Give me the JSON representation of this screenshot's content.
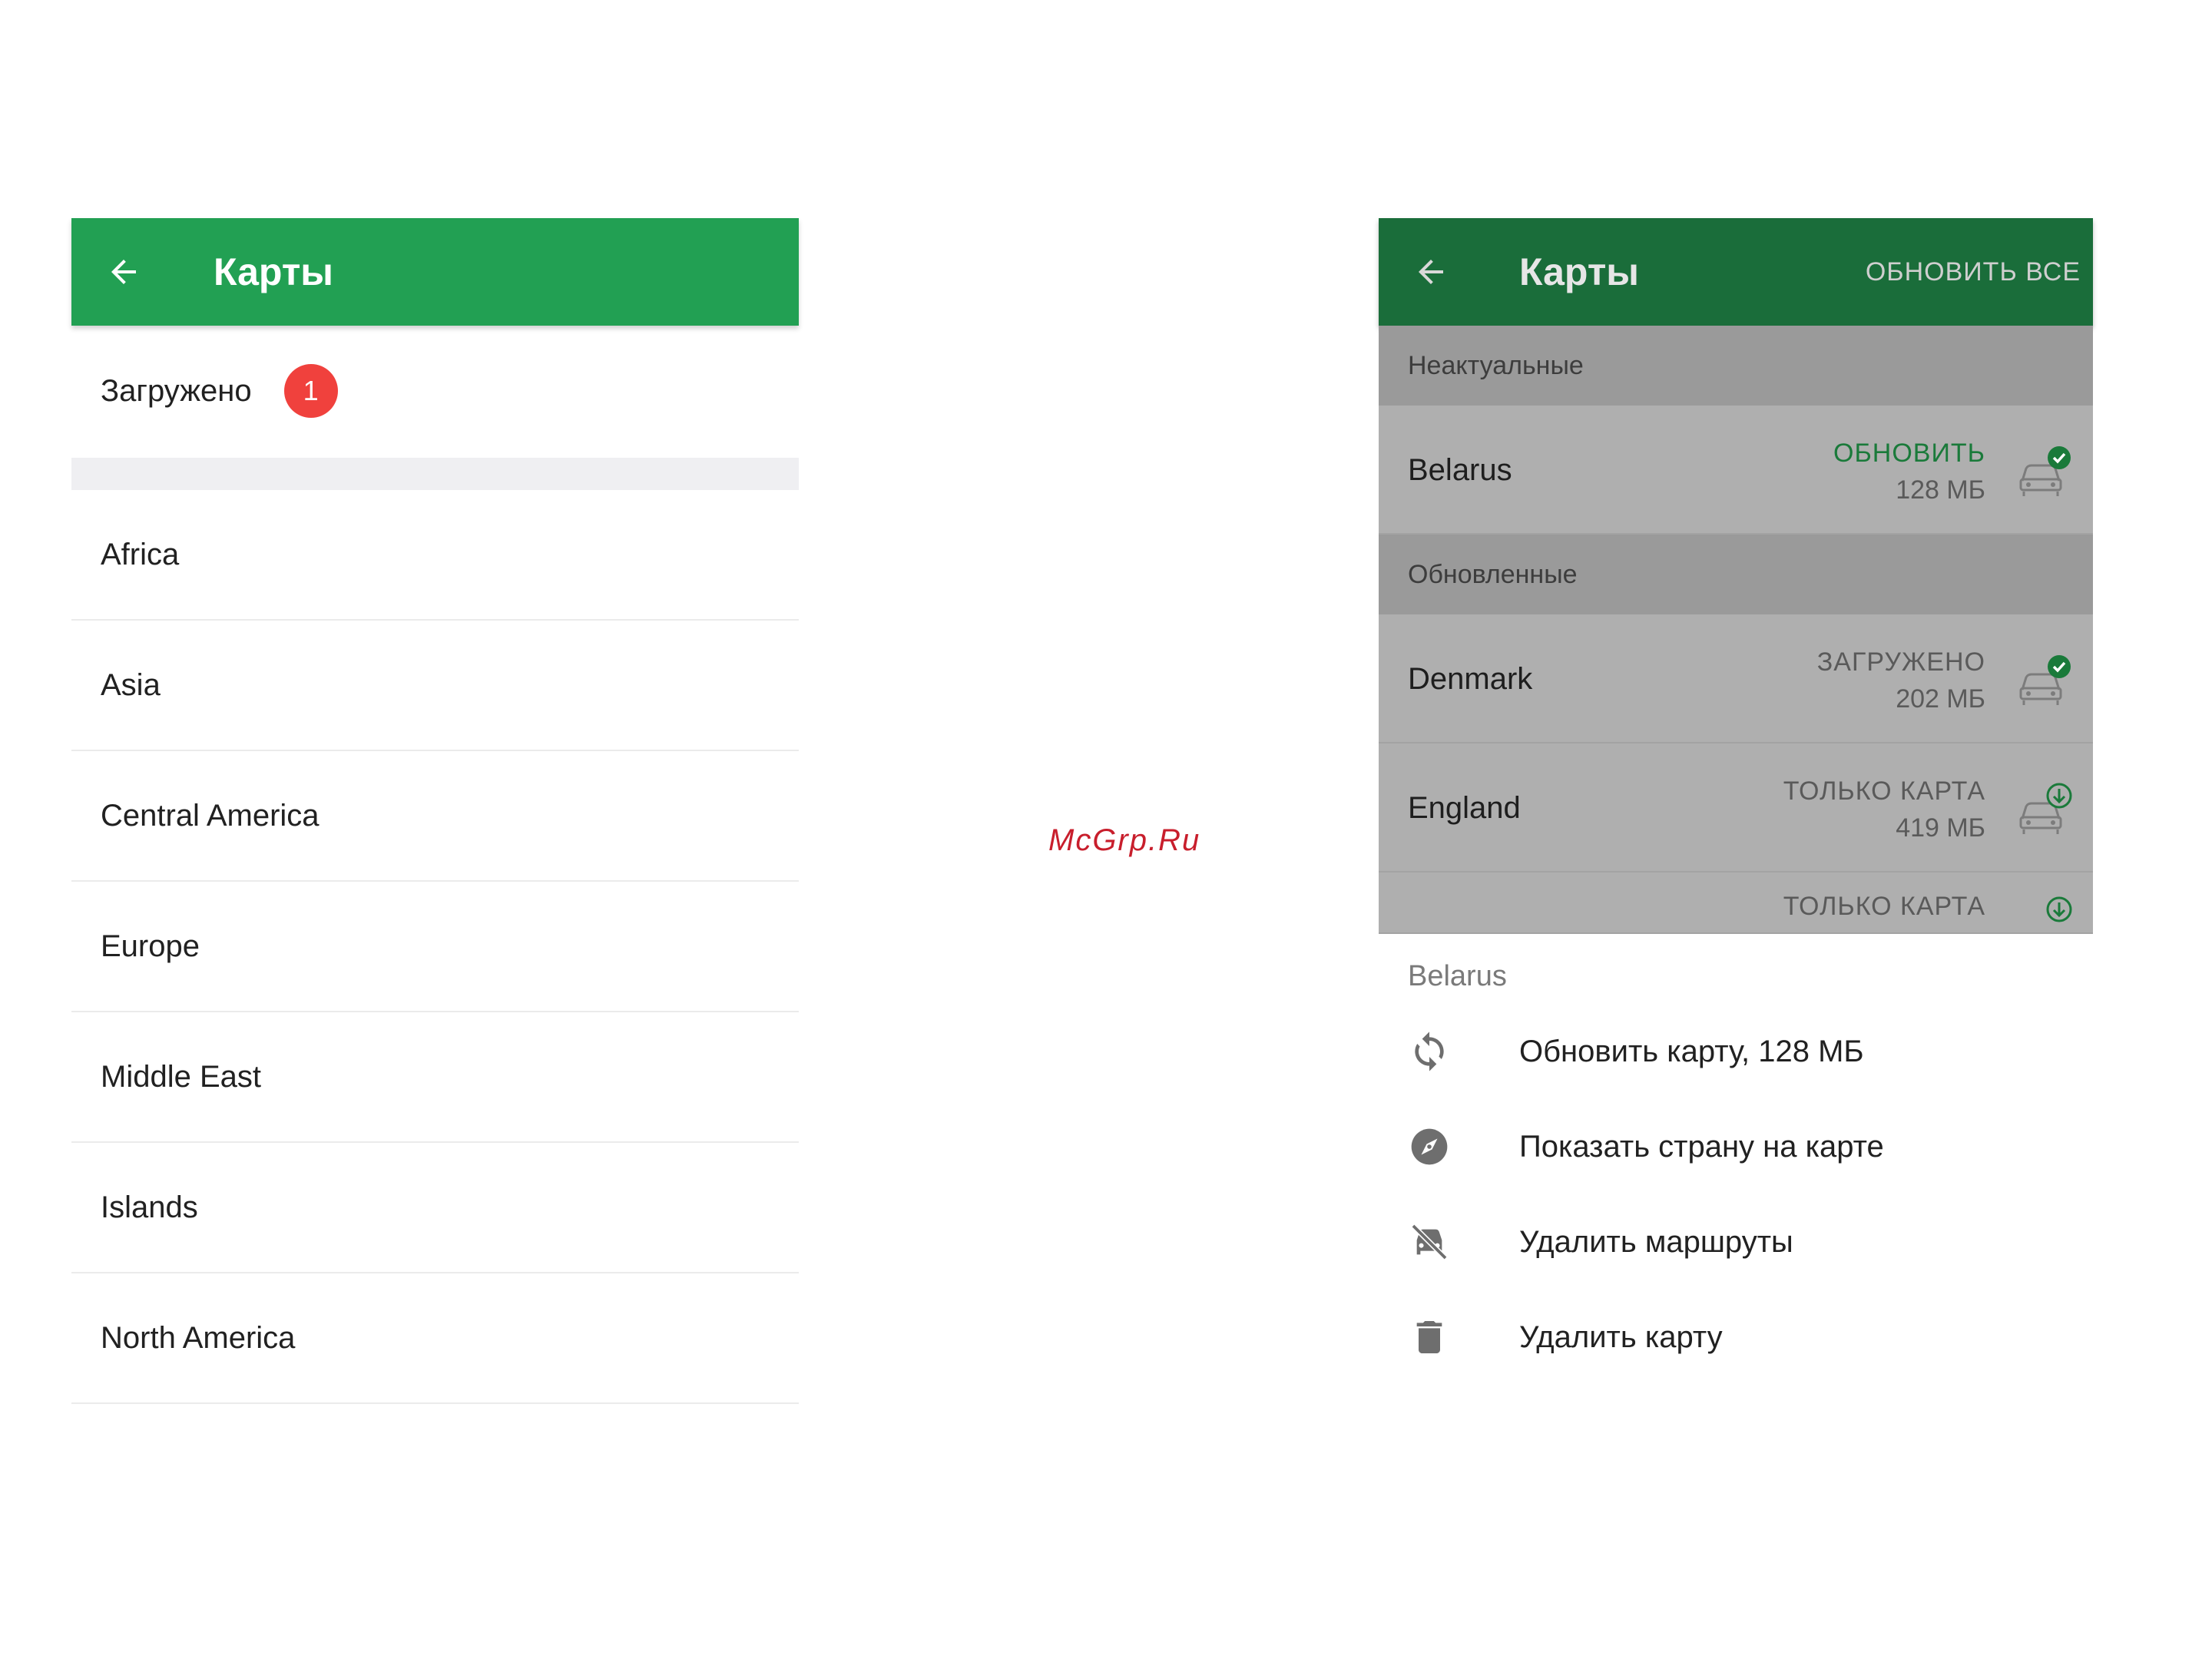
{
  "left": {
    "toolbar": {
      "back_icon": "arrow-back-icon",
      "title": "Карты",
      "color": "#22a053"
    },
    "downloaded": {
      "label": "Загружено",
      "badge_count": "1"
    },
    "regions": [
      "Africa",
      "Asia",
      "Central America",
      "Europe",
      "Middle East",
      "Islands",
      "North America"
    ]
  },
  "watermark": "McGrp.Ru",
  "right": {
    "toolbar": {
      "back_icon": "arrow-back-icon",
      "title": "Карты",
      "update_all": "ОБНОВИТЬ ВСЕ",
      "color": "#1a6d3a"
    },
    "sections": {
      "outdated": "Неактуальные",
      "updated": "Обновленные"
    },
    "countries": [
      {
        "name": "Belarus",
        "status": "ОБНОВИТЬ",
        "size": "128 МБ",
        "icon": "car-check-icon"
      },
      {
        "name": "Denmark",
        "status": "ЗАГРУЖЕНО",
        "size": "202 МБ",
        "icon": "car-check-icon"
      },
      {
        "name": "England",
        "status": "ТОЛЬКО КАРТА",
        "size": "419 МБ",
        "icon": "car-download-icon"
      },
      {
        "name": "",
        "status": "ТОЛЬКО КАРТА",
        "size": "",
        "icon": "car-download-icon"
      }
    ],
    "sheet": {
      "title": "Belarus",
      "items": [
        {
          "label": "Обновить карту, 128 МБ",
          "icon": "refresh-icon"
        },
        {
          "label": "Показать страну на карте",
          "icon": "compass-icon"
        },
        {
          "label": "Удалить маршруты",
          "icon": "car-off-icon"
        },
        {
          "label": "Удалить карту",
          "icon": "trash-icon"
        }
      ]
    }
  }
}
